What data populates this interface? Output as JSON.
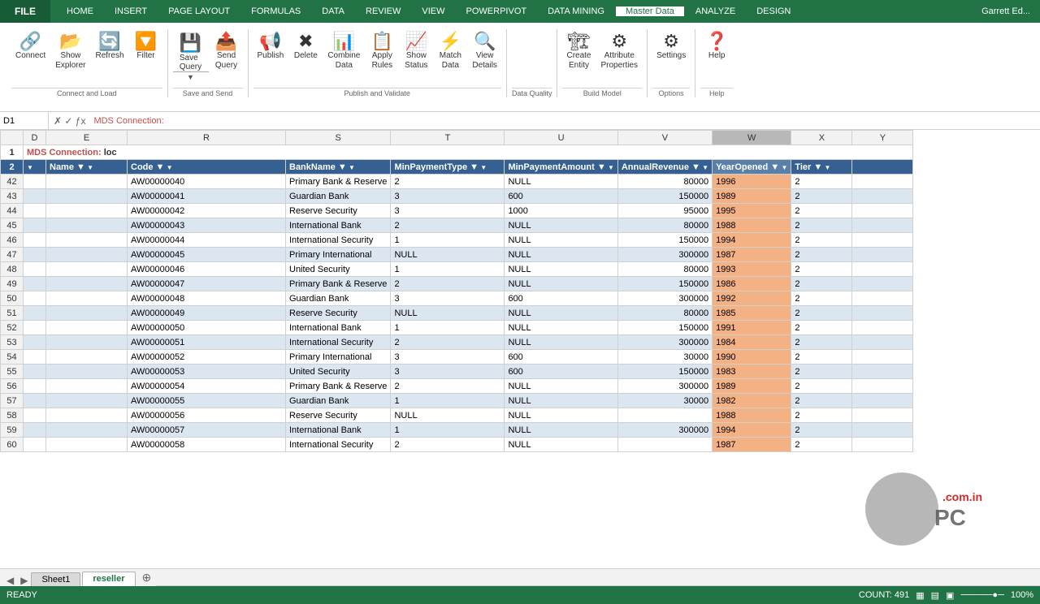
{
  "titlebar": {
    "file_label": "FILE",
    "tabs": [
      "HOME",
      "INSERT",
      "PAGE LAYOUT",
      "FORMULAS",
      "DATA",
      "REVIEW",
      "VIEW",
      "POWERPIVOT",
      "DATA MINING",
      "Master Data",
      "ANALYZE",
      "DESIGN"
    ],
    "active_tab": "Master Data",
    "user": "Garrett Ed..."
  },
  "ribbon": {
    "groups": [
      {
        "name": "Connect and Load",
        "buttons": [
          {
            "id": "connect",
            "icon": "🔗",
            "label": "Connect",
            "split": false
          },
          {
            "id": "show-explorer",
            "icon": "📂",
            "label": "Show Explorer",
            "split": false
          },
          {
            "id": "refresh",
            "icon": "🔄",
            "label": "Refresh",
            "split": false
          },
          {
            "id": "filter",
            "icon": "🔽",
            "label": "Filter",
            "split": false
          }
        ]
      },
      {
        "name": "Save and Send",
        "buttons": [
          {
            "id": "save-query",
            "icon": "💾",
            "label": "Save Query",
            "split": true
          },
          {
            "id": "send-query",
            "icon": "📤",
            "label": "Send Query",
            "split": false
          }
        ]
      },
      {
        "name": "Publish and Validate",
        "buttons": [
          {
            "id": "publish",
            "icon": "📢",
            "label": "Publish",
            "split": false
          },
          {
            "id": "delete",
            "icon": "✖",
            "label": "Delete",
            "split": false
          },
          {
            "id": "combine-data",
            "icon": "📊",
            "label": "Combine Data",
            "split": false
          },
          {
            "id": "apply-rules",
            "icon": "📋",
            "label": "Apply Rules",
            "split": false
          },
          {
            "id": "show-status",
            "icon": "📈",
            "label": "Show Status",
            "split": false
          },
          {
            "id": "match",
            "icon": "⚡",
            "label": "Match",
            "split": false
          },
          {
            "id": "view-details",
            "icon": "🔍",
            "label": "View Details",
            "split": false
          }
        ]
      },
      {
        "name": "Data Quality",
        "buttons": []
      },
      {
        "name": "Build Model",
        "buttons": [
          {
            "id": "create-entity",
            "icon": "🏗",
            "label": "Create Entity",
            "split": false
          },
          {
            "id": "attribute-properties",
            "icon": "⚙",
            "label": "Attribute Properties",
            "split": false
          }
        ]
      },
      {
        "name": "Options",
        "buttons": [
          {
            "id": "settings",
            "icon": "⚙",
            "label": "Settings",
            "split": false
          }
        ]
      },
      {
        "name": "Help",
        "buttons": [
          {
            "id": "help",
            "icon": "❓",
            "label": "Help",
            "split": false
          }
        ]
      }
    ]
  },
  "mds_connection": {
    "label": "MDS Connection:",
    "value": "loc"
  },
  "column_headers": [
    "D",
    "E",
    "R",
    "S",
    "T",
    "U",
    "V",
    "W",
    "X",
    "Y"
  ],
  "field_headers": [
    "Name",
    "Code",
    "BankName",
    "MinPaymentType",
    "MinPaymentAmount",
    "AnnualRevenue",
    "YearOpened",
    "Tier"
  ],
  "rows": [
    {
      "num": 42,
      "name": "",
      "code": "AW00000040",
      "bank": "Primary Bank & Reserve",
      "mintype": "2",
      "minamount": "NULL",
      "revenue": "80000",
      "year": "1996",
      "tier": "2"
    },
    {
      "num": 43,
      "name": "",
      "code": "AW00000041",
      "bank": "Guardian Bank",
      "mintype": "3",
      "minamount": "600",
      "revenue": "150000",
      "year": "1989",
      "tier": "2"
    },
    {
      "num": 44,
      "name": "",
      "code": "AW00000042",
      "bank": "Reserve Security",
      "mintype": "3",
      "minamount": "1000",
      "revenue": "95000",
      "year": "1995",
      "tier": "2"
    },
    {
      "num": 45,
      "name": "",
      "code": "AW00000043",
      "bank": "International Bank",
      "mintype": "2",
      "minamount": "NULL",
      "revenue": "80000",
      "year": "1988",
      "tier": "2"
    },
    {
      "num": 46,
      "name": "",
      "code": "AW00000044",
      "bank": "International Security",
      "mintype": "1",
      "minamount": "NULL",
      "revenue": "150000",
      "year": "1994",
      "tier": "2"
    },
    {
      "num": 47,
      "name": "",
      "code": "AW00000045",
      "bank": "Primary International",
      "mintype": "NULL",
      "minamount": "NULL",
      "revenue": "300000",
      "year": "1987",
      "tier": "2"
    },
    {
      "num": 48,
      "name": "",
      "code": "AW00000046",
      "bank": "United Security",
      "mintype": "1",
      "minamount": "NULL",
      "revenue": "80000",
      "year": "1993",
      "tier": "2"
    },
    {
      "num": 49,
      "name": "",
      "code": "AW00000047",
      "bank": "Primary Bank & Reserve",
      "mintype": "2",
      "minamount": "NULL",
      "revenue": "150000",
      "year": "1986",
      "tier": "2"
    },
    {
      "num": 50,
      "name": "",
      "code": "AW00000048",
      "bank": "Guardian Bank",
      "mintype": "3",
      "minamount": "600",
      "revenue": "300000",
      "year": "1992",
      "tier": "2"
    },
    {
      "num": 51,
      "name": "",
      "code": "AW00000049",
      "bank": "Reserve Security",
      "mintype": "NULL",
      "minamount": "NULL",
      "revenue": "80000",
      "year": "1985",
      "tier": "2"
    },
    {
      "num": 52,
      "name": "",
      "code": "AW00000050",
      "bank": "International Bank",
      "mintype": "1",
      "minamount": "NULL",
      "revenue": "150000",
      "year": "1991",
      "tier": "2"
    },
    {
      "num": 53,
      "name": "",
      "code": "AW00000051",
      "bank": "International Security",
      "mintype": "2",
      "minamount": "NULL",
      "revenue": "300000",
      "year": "1984",
      "tier": "2"
    },
    {
      "num": 54,
      "name": "",
      "code": "AW00000052",
      "bank": "Primary International",
      "mintype": "3",
      "minamount": "600",
      "revenue": "30000",
      "year": "1990",
      "tier": "2"
    },
    {
      "num": 55,
      "name": "",
      "code": "AW00000053",
      "bank": "United Security",
      "mintype": "3",
      "minamount": "600",
      "revenue": "150000",
      "year": "1983",
      "tier": "2"
    },
    {
      "num": 56,
      "name": "",
      "code": "AW00000054",
      "bank": "Primary Bank & Reserve",
      "mintype": "2",
      "minamount": "NULL",
      "revenue": "300000",
      "year": "1989",
      "tier": "2"
    },
    {
      "num": 57,
      "name": "",
      "code": "AW00000055",
      "bank": "Guardian Bank",
      "mintype": "1",
      "minamount": "NULL",
      "revenue": "30000",
      "year": "1982",
      "tier": "2"
    },
    {
      "num": 58,
      "name": "",
      "code": "AW00000056",
      "bank": "Reserve Security",
      "mintype": "NULL",
      "minamount": "NULL",
      "revenue": "",
      "year": "1988",
      "tier": "2"
    },
    {
      "num": 59,
      "name": "",
      "code": "AW00000057",
      "bank": "International Bank",
      "mintype": "1",
      "minamount": "NULL",
      "revenue": "300000",
      "year": "1994",
      "tier": "2"
    },
    {
      "num": 60,
      "name": "",
      "code": "AW00000058",
      "bank": "International Security",
      "mintype": "2",
      "minamount": "NULL",
      "revenue": "",
      "year": "1987",
      "tier": "2"
    }
  ],
  "status_bar": {
    "ready": "READY",
    "count": "COUNT: 491"
  },
  "sheet_tabs": [
    "Sheet1",
    "reseller"
  ],
  "active_sheet": "reseller"
}
